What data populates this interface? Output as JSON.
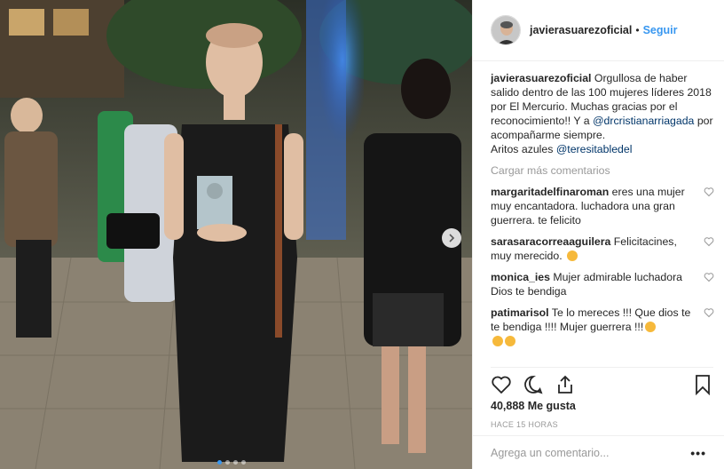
{
  "post": {
    "image_alt": "Mujer con trofeo en evento",
    "carousel": {
      "count": 4,
      "active": 1
    }
  },
  "header": {
    "username": "javierasuarezoficial",
    "separator": "•",
    "follow_label": "Seguir"
  },
  "caption": {
    "username": "javierasuarezoficial",
    "text_1": " Orgullosa de haber salido dentro de las 100 mujeres líderes 2018 por El Mercurio. Muchas gracias por el reconocimiento!! Y a ",
    "mention_1": "@drcristianarriagada",
    "text_2": " por acompañarme siempre.",
    "text_3": "Aritos azules ",
    "mention_2": "@teresitabledel"
  },
  "load_more": "Cargar más comentarios",
  "comments": [
    {
      "user": "margaritadelfinaroman",
      "text": " eres una mujer muy encantadora. luchadora una gran guerrera. te felicito"
    },
    {
      "user": "sarasaracorreaaguilera",
      "text": " Felicitacines, muy merecido. "
    },
    {
      "user": "monica_ies",
      "text": " Mujer admirable luchadora Dios te bendiga"
    },
    {
      "user": "patimarisol",
      "text": " Te lo mereces !!! Que dios te te bendiga !!!! Mujer guerrera !!!"
    }
  ],
  "likes": "40,888 Me gusta",
  "timestamp": "HACE 15 HORAS",
  "comment_box": {
    "placeholder": "Agrega un comentario...",
    "more_label": "•••"
  },
  "icons": {
    "like": "heart-icon",
    "comment": "comment-icon",
    "share": "share-icon",
    "save": "bookmark-icon",
    "next": "chevron-right-icon"
  },
  "colors": {
    "link": "#3897f0",
    "mention": "#003569",
    "muted": "#999999",
    "border": "#efefef"
  }
}
